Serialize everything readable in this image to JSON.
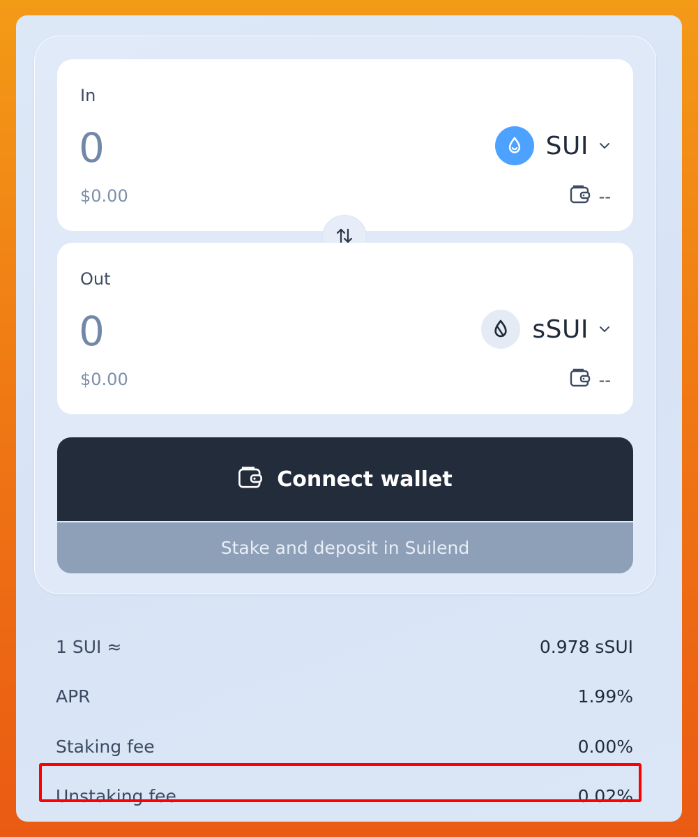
{
  "in_card": {
    "label": "In",
    "amount": "0",
    "usd": "$0.00",
    "token": "SUI",
    "token_icon": "sui-droplet-icon",
    "balance": "--"
  },
  "out_card": {
    "label": "Out",
    "amount": "0",
    "usd": "$0.00",
    "token": "sSUI",
    "token_icon": "ssui-droplet-icon",
    "balance": "--"
  },
  "swap_icon": "swap-arrows-icon",
  "connect_button": {
    "label": "Connect wallet",
    "icon": "wallet-icon"
  },
  "stake_button": {
    "label": "Stake and deposit in Suilend"
  },
  "stats": [
    {
      "label": "1 SUI ≈",
      "value": "0.978 sSUI"
    },
    {
      "label": "APR",
      "value": "1.99%"
    },
    {
      "label": "Staking fee",
      "value": "0.00%"
    },
    {
      "label": "Unstaking fee",
      "value": "0.02%"
    }
  ],
  "colors": {
    "sui_blue": "#4da2ff",
    "dark_button": "#232c3b",
    "disabled_button": "#8e9fb8",
    "highlight_red": "#ff0000",
    "background_orange": "#f07a14"
  }
}
